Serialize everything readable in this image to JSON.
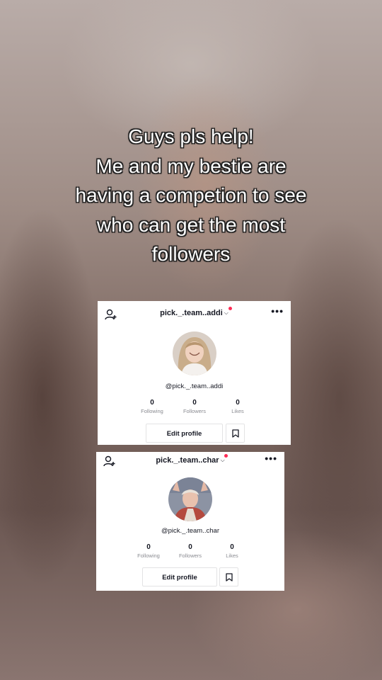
{
  "caption": {
    "line1": "Guys pls help!",
    "line2": "Me and my bestie are",
    "line3": "having a competion to see",
    "line4": "who can get the most",
    "line5": "followers"
  },
  "profiles": [
    {
      "username": "pick._.team..addi",
      "handle": "@pick._.team..addi",
      "following": "0",
      "following_label": "Following",
      "followers": "0",
      "followers_label": "Followers",
      "likes": "0",
      "likes_label": "Likes",
      "edit_label": "Edit profile"
    },
    {
      "username": "pick._.team..char",
      "handle": "@pick._.team..char",
      "following": "0",
      "following_label": "Following",
      "followers": "0",
      "followers_label": "Followers",
      "likes": "0",
      "likes_label": "Likes",
      "edit_label": "Edit profile"
    }
  ],
  "icons": {
    "add_friend": "add-user-icon",
    "chevron": "chevron-down-icon",
    "more": "more-icon",
    "bookmark": "bookmark-icon"
  },
  "colors": {
    "notification_dot": "#fe2c55",
    "text_primary": "#161823",
    "text_secondary": "#8a8b91"
  }
}
